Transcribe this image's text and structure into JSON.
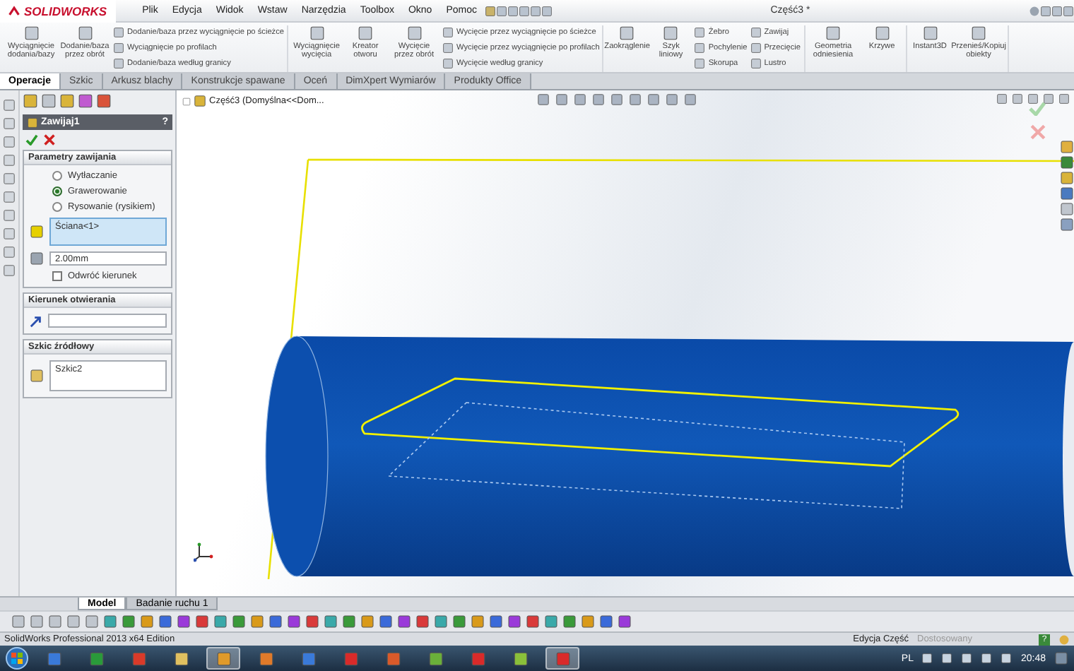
{
  "window": {
    "logo": "SOLIDWORKS",
    "title": "Część3 *"
  },
  "menu": [
    "Plik",
    "Edycja",
    "Widok",
    "Wstaw",
    "Narzędzia",
    "Toolbox",
    "Okno",
    "Pomoc"
  ],
  "ribbon": {
    "groups": [
      {
        "large": [
          "Wyciągnięcie dodania/bazy",
          "Dodanie/baza przez obrót"
        ],
        "columns": [
          [
            "Dodanie/baza przez wyciągnięcie po ścieżce",
            "Wyciągnięcie po profilach",
            "Dodanie/baza według granicy"
          ]
        ]
      },
      {
        "large": [
          "Wyciągnięcie wycięcia",
          "Kreator otworu",
          "Wycięcie przez obrót"
        ],
        "columns": [
          [
            "Wycięcie przez wyciągnięcie po ścieżce",
            "Wycięcie przez wyciągnięcie po profilach",
            "Wycięcie według granicy"
          ]
        ]
      },
      {
        "large": [
          "Zaokrąglenie",
          "Szyk liniowy"
        ],
        "columns": [
          [
            "Żebro",
            "Pochylenie",
            "Skorupa"
          ],
          [
            "Zawijaj",
            "Przecięcie",
            "Lustro"
          ]
        ]
      },
      {
        "large": [
          "Geometria odniesienia",
          "Krzywe"
        ]
      },
      {
        "large": [
          "Instant3D",
          "Przenieś/Kopiuj obiekty"
        ]
      }
    ]
  },
  "tabs": [
    {
      "label": "Operacje",
      "selected": true
    },
    {
      "label": "Szkic",
      "selected": false
    },
    {
      "label": "Arkusz blachy",
      "selected": false
    },
    {
      "label": "Konstrukcje spawane",
      "selected": false
    },
    {
      "label": "Oceń",
      "selected": false
    },
    {
      "label": "DimXpert Wymiarów",
      "selected": false
    },
    {
      "label": "Produkty Office",
      "selected": false
    }
  ],
  "property_manager": {
    "title": "Zawijaj1",
    "help": "?",
    "parameters": {
      "title": "Parametry zawijania",
      "options": [
        {
          "label": "Wytłaczanie",
          "selected": false
        },
        {
          "label": "Grawerowanie",
          "selected": true
        },
        {
          "label": "Rysowanie (rysikiem)",
          "selected": false
        }
      ],
      "face": "Ściana<1>",
      "depth": "2.00mm",
      "reverse": {
        "label": "Odwróć kierunek",
        "checked": false
      }
    },
    "direction": {
      "title": "Kierunek otwierania"
    },
    "source_sketch": {
      "title": "Szkic źródłowy",
      "item": "Szkic2"
    }
  },
  "tree": {
    "item": "Część3  (Domyślna<<Dom..."
  },
  "bottom_tabs": [
    {
      "label": "Model",
      "selected": true
    },
    {
      "label": "Badanie ruchu 1",
      "selected": false
    }
  ],
  "status_bar": {
    "product": "SolidWorks Professional 2013 x64 Edition",
    "mode": "Edycja Część",
    "units": "Dostosowany",
    "help": "?"
  },
  "taskbar": {
    "language": "PL",
    "time": "20:48"
  }
}
